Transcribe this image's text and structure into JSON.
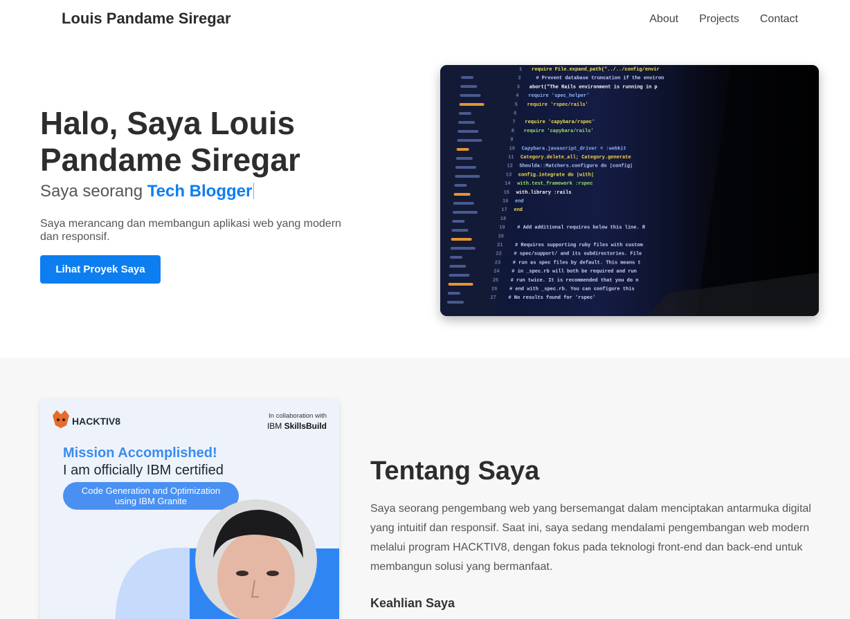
{
  "nav": {
    "brand": "Louis Pandame Siregar",
    "links": [
      "About",
      "Projects",
      "Contact"
    ]
  },
  "hero": {
    "title": "Halo, Saya Louis Pandame Siregar",
    "subtitle_prefix": "Saya seorang",
    "subtitle_role": "Tech Blogger",
    "description": "Saya merancang dan membangun aplikasi web yang modern dan responsif.",
    "cta_label": "Lihat Proyek Saya"
  },
  "cert": {
    "brand": "HACKTIV8",
    "collab_label": "In collaboration with",
    "collab_ibm": "IBM",
    "collab_skills": "SkillsBuild",
    "headline": "Mission Accomplished!",
    "subline": "I am officially IBM certified",
    "course_line1": "Code Generation and Optimization",
    "course_line2": "using IBM Granite"
  },
  "about": {
    "title": "Tentang Saya",
    "text": "Saya seorang pengembang web yang bersemangat dalam menciptakan antarmuka digital yang intuitif dan responsif. Saat ini, saya sedang mendalami pengembangan web modern melalui program HACKTIV8, dengan fokus pada teknologi front-end dan back-end untuk membangun solusi yang bermanfaat.",
    "skills_title": "Keahlian Saya"
  },
  "code_lines": [
    "require File.expand_path(\"../../config/environment\", __FILE__)",
    "# Prevent database truncation if the environment is production",
    "abort(\"The Rails environment is running in production mode!\")",
    "require 'spec_helper'",
    "require 'rspec/rails'",
    "",
    "require 'capybara/rspec'",
    "require 'capybara/rails'",
    "",
    "Capybara.javascript_driver = :webkit",
    "Category.delete_all; Category.generate",
    "Shoulda::Matchers.configure do |config|",
    "config.integrate do |with|",
    "with.test_framework :rspec",
    "with.library :rails",
    "end",
    "end",
    "",
    "# Add additional requires below this line. Rails is not loaded until",
    "",
    "# Requires supporting ruby files with custom matchers and macros",
    "# spec/support/ and its subdirectories. Files matching",
    "# run as spec files by default. This means that files",
    "# in _spec.rb will both be required and run as specs",
    "# run twice. It is recommended that you do not name",
    "# end with _spec.rb. You can configure this pattern",
    "# No results found for 'rspec'"
  ],
  "colors": {
    "accent": "#0d7ef0",
    "about_bg": "#f7f7f7",
    "heading": "#2d2d2d"
  }
}
